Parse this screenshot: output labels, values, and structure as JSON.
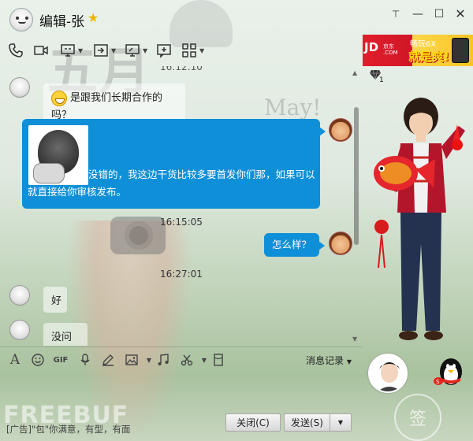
{
  "titlebar": {
    "contact_name": "编辑-张",
    "vip_icon": "star-icon",
    "minimize": "minimize-icon",
    "maximize": "maximize-icon",
    "close": "close-icon"
  },
  "toolbar": {
    "items": [
      "phone-icon",
      "video-icon",
      "screen-share-icon",
      "send-file-icon",
      "remote-desktop-icon",
      "add-to-chat-icon",
      "apps-grid-icon"
    ]
  },
  "chat": {
    "partial_timestamp": "16:12:10",
    "messages": [
      {
        "side": "left",
        "emoji": "grin-emoji-icon",
        "text": "是跟我们长期合作的吗？"
      },
      {
        "side": "right",
        "image": "meme-image",
        "text": "没错的，我这边干货比较多要首发你们那，如果可以就直接给你审核发布。"
      },
      {
        "timestamp": "16:15:05"
      },
      {
        "side": "right",
        "text": "怎么样？"
      },
      {
        "timestamp": "16:27:01"
      },
      {
        "side": "left",
        "text": "好"
      },
      {
        "side": "left",
        "text": "没问题"
      }
    ]
  },
  "input_toolbar": {
    "items": [
      "font-icon",
      "emoji-icon",
      "gif-icon",
      "voice-icon",
      "pen-icon",
      "image-icon",
      "music-icon",
      "screenshot-icon",
      "red-packet-icon"
    ],
    "history_label": "消息记录"
  },
  "bottom": {
    "ad_text": "[广告]\"包\"你满意，有型，有面",
    "close_label": "关闭(C)",
    "send_label": "发送(S)"
  },
  "right_panel": {
    "ad_brand": "JD京东",
    "ad_brand_small": "京东\n.COM",
    "ad_line1": "畅玩6X",
    "ad_line2": "就是爽!",
    "diamond_count": "1",
    "badge_text": "签"
  },
  "watermarks": {
    "top": "五月",
    "may": "May!",
    "brand": "FREEBUF"
  }
}
